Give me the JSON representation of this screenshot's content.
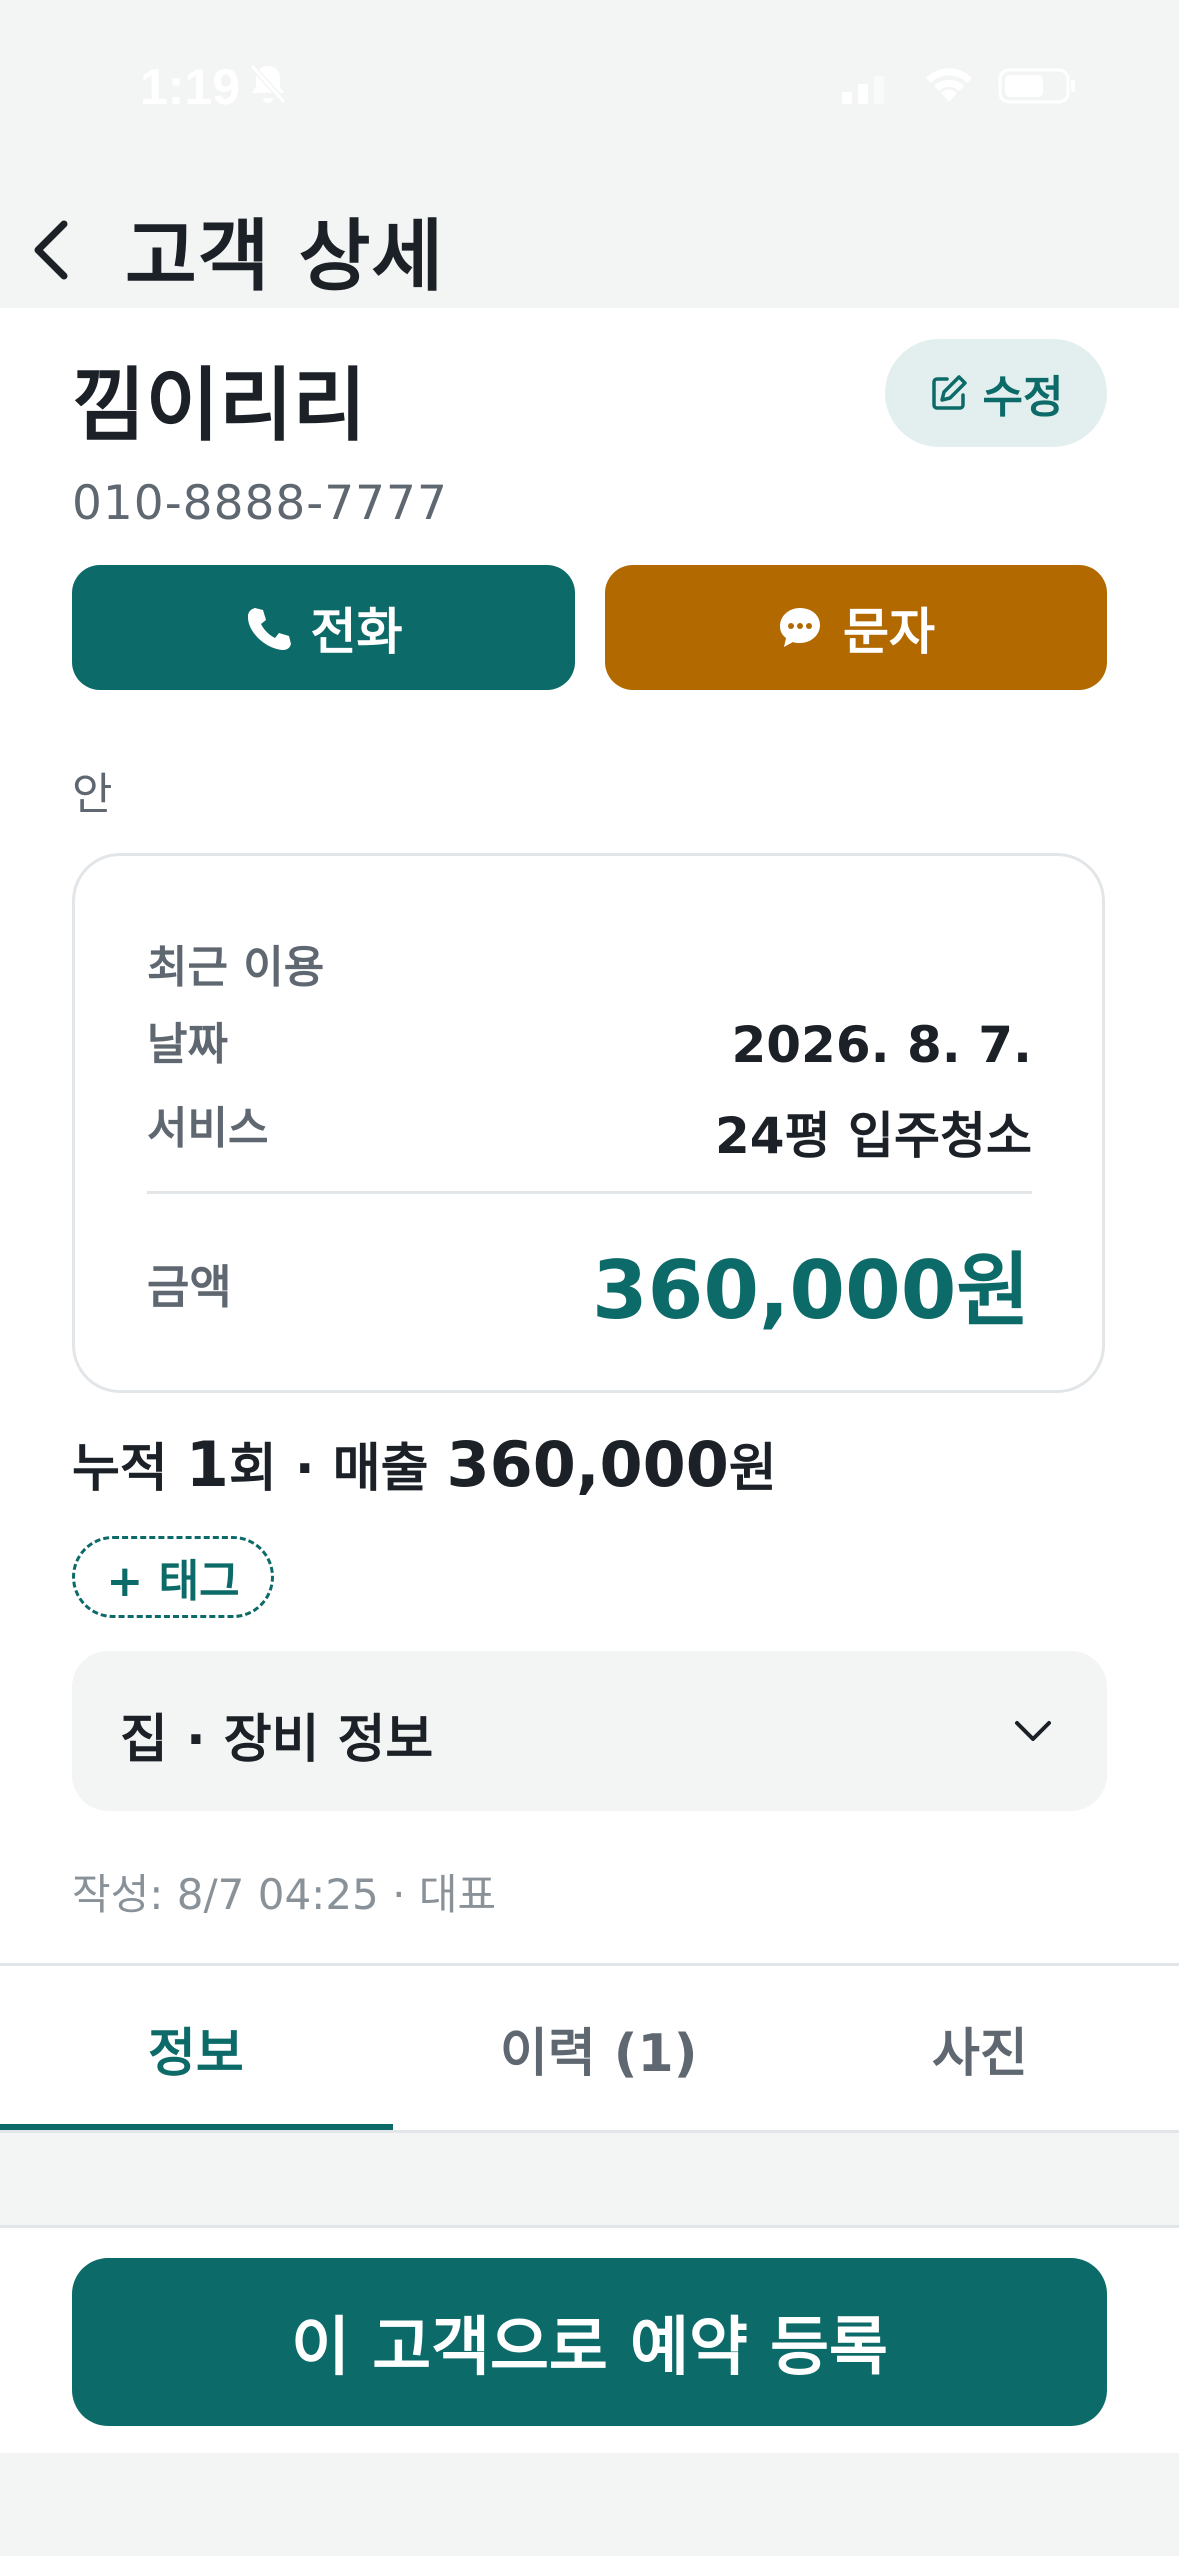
{
  "status_bar": {
    "time": "1:19"
  },
  "header": {
    "title": "고객 상세"
  },
  "customer": {
    "name": "낌이리리",
    "phone": "010-8888-7777",
    "edit_label": "수정",
    "call_label": "전화",
    "sms_label": "문자",
    "note": "안"
  },
  "recent": {
    "label": "최근 이용",
    "date_key": "날짜",
    "date_value": "2026. 8. 7.",
    "service_key": "서비스",
    "service_value": "24평 입주청소",
    "amount_key": "금액",
    "amount_value": "360,000원"
  },
  "summary": {
    "prefix": "누적 ",
    "count": "1",
    "mid": "회 · 매출 ",
    "sales": "360,000",
    "suffix": "원"
  },
  "tag_button": "+ 태그",
  "accordion": {
    "title": "집 · 장비 정보"
  },
  "meta": "작성: 8/7 04:25 · 대표",
  "tabs": [
    {
      "label": "정보",
      "active": true
    },
    {
      "label": "이력 (1)",
      "active": false
    },
    {
      "label": "사진",
      "active": false
    }
  ],
  "book_button": "이 고객으로 예약 등록",
  "colors": {
    "primary": "#0C6A68",
    "sms": "#B26A00",
    "muted": "#5F6870"
  },
  "icons": [
    "back-icon",
    "edit-icon",
    "phone-icon",
    "chat-icon",
    "chevron-down-icon"
  ]
}
